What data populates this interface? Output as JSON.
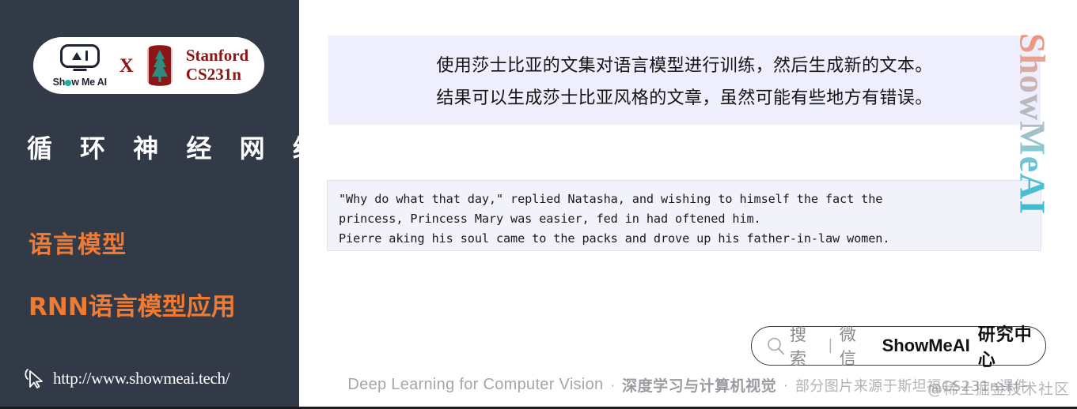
{
  "sidebar": {
    "logo": {
      "brand_word": "Show Me AI",
      "cross": "X",
      "stanford_line1": "Stanford",
      "stanford_line2": "CS231n",
      "brand_icon": "showmeai-robot-icon",
      "stanford_icon": "stanford-tree-icon"
    },
    "title": "循 环 神 经 网 络",
    "subtitle_1": "语言模型",
    "subtitle_2": "RNN语言模型应用",
    "url": "http://www.showmeai.tech/",
    "cursor_icon": "mouse-pointer-icon",
    "colors": {
      "background": "#323a47",
      "accent": "#f07a32",
      "title": "#ffffff"
    }
  },
  "main": {
    "description": {
      "line_1": "使用莎士比亚的文集对语言模型进行训练，然后生成新的文本。",
      "line_2": "结果可以生成莎士比亚风格的文章，虽然可能有些地方有错误。",
      "background": "#eeeefc"
    },
    "code_output": {
      "line_1": "\"Why do what that day,\" replied Natasha, and wishing to himself the fact the",
      "line_2": "princess, Princess Mary was easier, fed in had oftened him.",
      "line_3": "Pierre aking his soul came to the packs and drove up his father-in-law women.",
      "background": "#f2f2fb"
    },
    "search_badge": {
      "search_icon": "magnifier-icon",
      "search_label": "搜索",
      "divider": "|",
      "platform": "微信",
      "brand": "ShowMeAI",
      "center": "研究中心"
    },
    "footer": {
      "english": "Deep Learning for Computer Vision",
      "dot_1": "·",
      "chinese_bold": "深度学习与计算机视觉",
      "dot_2": "·",
      "source_note": "部分图片来源于斯坦福CS231n课件"
    },
    "watermark_vertical": "ShowMeAI",
    "watermark_juejin": "@稀土掘金技术社区"
  }
}
